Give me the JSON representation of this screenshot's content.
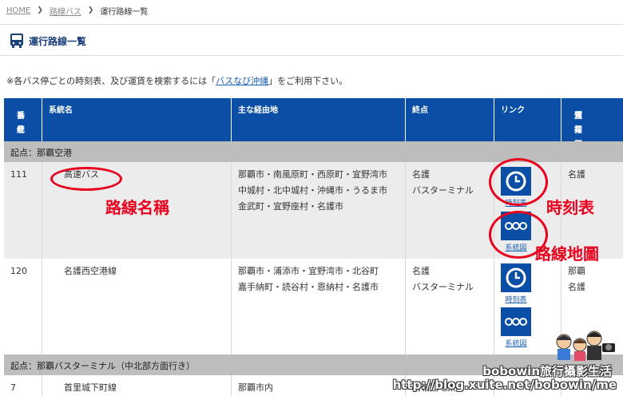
{
  "breadcrumb": {
    "home": "HOME",
    "route_bus": "路線バス",
    "current": "運行路線一覧"
  },
  "page_title": "運行路線一覧",
  "notice": {
    "prefix": "※各バス停ごとの時刻表、及び運賃を検索するには「",
    "link": "バスなび沖縄",
    "suffix": "」をご利用下さい。"
  },
  "table": {
    "headers": {
      "number": [
        "系統",
        "番号"
      ],
      "name": "系統名",
      "via": "主な経由地",
      "terminal": "終点",
      "link": "リンク",
      "office": [
        "運行担当",
        "営業所"
      ]
    },
    "groups": [
      "起点：那覇空港",
      "起点：那覇バスターミナル（中北部方面行き）"
    ],
    "rows": [
      {
        "number": "111",
        "name": "高速バス",
        "via": [
          "那覇市・南風原町・西原町・宜野湾市",
          "中城村・北中城村・沖縄市・うるま市",
          "金武町・宜野座村・名護市"
        ],
        "terminal": [
          "名護",
          "バスターミナル"
        ],
        "links": {
          "timetable": "時刻表",
          "routemap": "系統図"
        },
        "office": [
          "名護"
        ]
      },
      {
        "number": "120",
        "name": "名護西空港線",
        "via": [
          "那覇市・浦添市・宜野湾市・北谷町",
          "嘉手納町・読谷村・恩納村・名護市"
        ],
        "terminal": [
          "名護",
          "バスターミナル"
        ],
        "links": {
          "timetable": "時刻表",
          "routemap": "系統図"
        },
        "office": [
          "那覇",
          "名護"
        ]
      },
      {
        "number": "7",
        "name": "首里城下町線",
        "via": [
          "那覇市内"
        ],
        "terminal": [
          "石嶺団地東"
        ]
      }
    ]
  },
  "annotations": {
    "route_name": "路線名稱",
    "timetable": "時刻表",
    "route_map": "路線地圖"
  },
  "watermark": {
    "brand": "bobowin旅行攝影生活",
    "url": "http://blog.xuite.net/bobowin/me"
  },
  "colors": {
    "header_blue": "#0a4ea5",
    "group_gray": "#bdbdbd",
    "annotation_red": "#e8001c"
  }
}
